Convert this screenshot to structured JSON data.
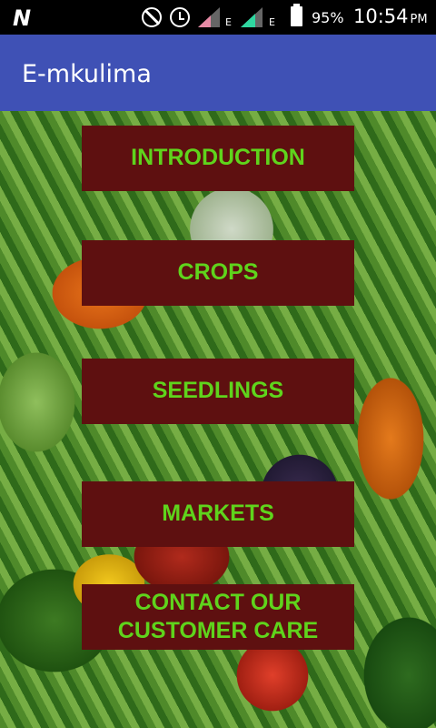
{
  "status_bar": {
    "carrier_icon": "n-logo-icon",
    "dnd_icon": "do-not-disturb-icon",
    "alarm_icon": "alarm-icon",
    "network_label_1": "E",
    "network_label_2": "E",
    "battery_percent": "95%",
    "time": "10:54",
    "ampm": "PM"
  },
  "app_bar": {
    "title": "E-mkulima",
    "color": "#3f51b5"
  },
  "menu": {
    "button_color": "#5e1010",
    "text_color": "#5fd41c",
    "items": [
      "INTRODUCTION",
      "CROPS",
      "SEEDLINGS",
      "MARKETS",
      "CONTACT OUR CUSTOMER CARE"
    ]
  }
}
